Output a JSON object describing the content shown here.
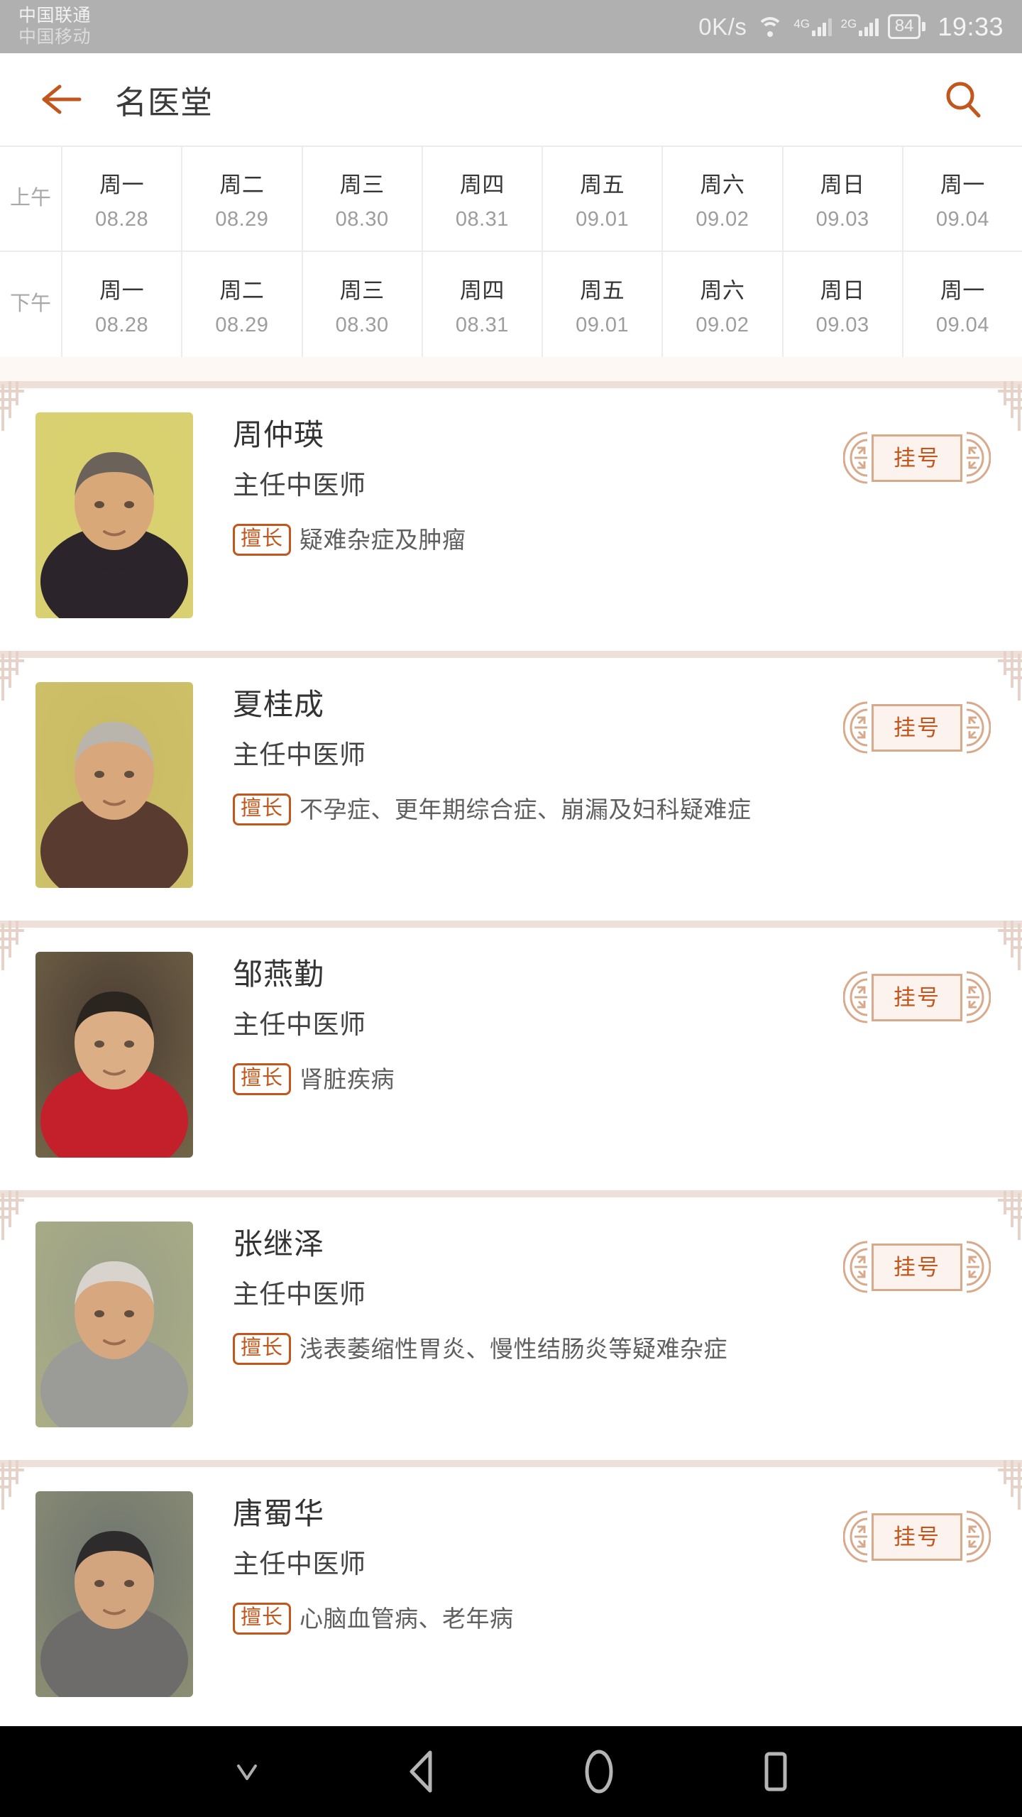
{
  "status_bar": {
    "carrier_primary": "中国联通",
    "carrier_secondary": "中国移动",
    "net_speed": "0K/s",
    "signal_1_label": "4G",
    "signal_2_label": "2G",
    "battery_level": "84",
    "time": "19:33",
    "icons": [
      "wifi-icon",
      "signal-icon",
      "battery-icon"
    ],
    "bg_color": "#b0b0b0"
  },
  "header": {
    "title": "名医堂",
    "back_icon": "back-arrow-icon",
    "search_icon": "search-icon",
    "accent_color": "#c1571c"
  },
  "schedule": {
    "rows": [
      {
        "period": "上午",
        "days": [
          {
            "name": "周一",
            "date": "08.28"
          },
          {
            "name": "周二",
            "date": "08.29"
          },
          {
            "name": "周三",
            "date": "08.30"
          },
          {
            "name": "周四",
            "date": "08.31"
          },
          {
            "name": "周五",
            "date": "09.01"
          },
          {
            "name": "周六",
            "date": "09.02"
          },
          {
            "name": "周日",
            "date": "09.03"
          },
          {
            "name": "周一",
            "date": "09.04"
          }
        ]
      },
      {
        "period": "下午",
        "days": [
          {
            "name": "周一",
            "date": "08.28"
          },
          {
            "name": "周二",
            "date": "08.29"
          },
          {
            "name": "周三",
            "date": "08.30"
          },
          {
            "name": "周四",
            "date": "08.31"
          },
          {
            "name": "周五",
            "date": "09.01"
          },
          {
            "name": "周六",
            "date": "09.02"
          },
          {
            "name": "周日",
            "date": "09.03"
          },
          {
            "name": "周一",
            "date": "09.04"
          }
        ]
      }
    ]
  },
  "doctor_list": {
    "specialty_tag_label": "擅长",
    "register_button_label": "挂号",
    "doctors": [
      {
        "name": "周仲瑛",
        "title": "主任中医师",
        "specialty": "疑难杂症及肿瘤",
        "photo_bg": "#d9d06f",
        "hair": "#6b6259",
        "skin": "#d9a878",
        "clothing": "#2b252b"
      },
      {
        "name": "夏桂成",
        "title": "主任中医师",
        "specialty": "不孕症、更年期综合症、崩漏及妇科疑难症",
        "photo_bg": "#c9bb63",
        "hair": "#b9b5ad",
        "skin": "#d8a87c",
        "clothing": "#5a3b30"
      },
      {
        "name": "邹燕勤",
        "title": "主任中医师",
        "specialty": "肾脏疾病",
        "photo_bg": "#4a3b33",
        "hair": "#2b2520",
        "skin": "#dcae86",
        "clothing": "#c4202c"
      },
      {
        "name": "张继泽",
        "title": "主任中医师",
        "specialty": "浅表萎缩性胃炎、慢性结肠炎等疑难杂症",
        "photo_bg": "#9aa089",
        "hair": "#d8d4cd",
        "skin": "#d7a87f",
        "clothing": "#9b9b97"
      },
      {
        "name": "唐蜀华",
        "title": "主任中医师",
        "specialty": "心脑血管病、老年病",
        "photo_bg": "#6e7470",
        "hair": "#2d2b2c",
        "skin": "#d3a57e",
        "clothing": "#6d6c6a"
      }
    ]
  },
  "nav_bar": {
    "buttons": [
      {
        "icon": "chevron-down-icon",
        "name": "hide-keyboard"
      },
      {
        "icon": "back-triangle-icon",
        "name": "back"
      },
      {
        "icon": "home-circle-icon",
        "name": "home"
      },
      {
        "icon": "recents-square-icon",
        "name": "recents"
      }
    ],
    "bg_color": "#000000"
  }
}
